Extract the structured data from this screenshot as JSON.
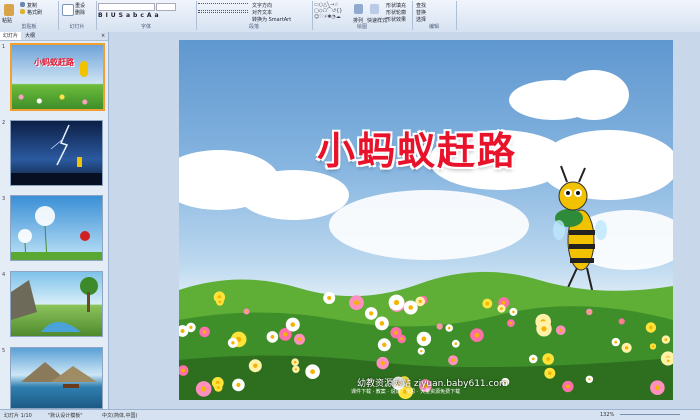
{
  "ribbon": {
    "groups": [
      "剪贴板",
      "幻灯片",
      "字体",
      "段落",
      "绘图",
      "编辑"
    ],
    "buttons": {
      "paste": "粘贴",
      "copy": "复制",
      "format_painter": "格式刷",
      "reset": "重设",
      "delete": "删除",
      "text_direction": "文字方向",
      "align_text": "对齐文本",
      "smartart": "转换为 SmartArt",
      "arrange": "排列",
      "quick_styles": "快速样式",
      "shape_fill": "形状填充",
      "shape_outline": "形状轮廓",
      "shape_effects": "形状效果",
      "find": "查找",
      "replace": "替换",
      "select": "选择"
    }
  },
  "panel": {
    "tabs": [
      "幻灯片",
      "大纲"
    ],
    "close": "×",
    "thumbnails": [
      {
        "num": "1",
        "title": "小蚂蚁赶路"
      },
      {
        "num": "2"
      },
      {
        "num": "3"
      },
      {
        "num": "4"
      },
      {
        "num": "5"
      }
    ]
  },
  "slide": {
    "title": "小蚂蚁赶路",
    "watermark": "幼教资源网站  ziyuan.baby611.com",
    "watermark_small": "课件下载 · 教案 · 说课 · 反思 · 大量资源免费下载"
  },
  "status": {
    "slide_info": "幻灯片 1/10",
    "theme": "\"默认设计模板\"",
    "language": "中文(简体,中国)",
    "zoom": "132%"
  }
}
